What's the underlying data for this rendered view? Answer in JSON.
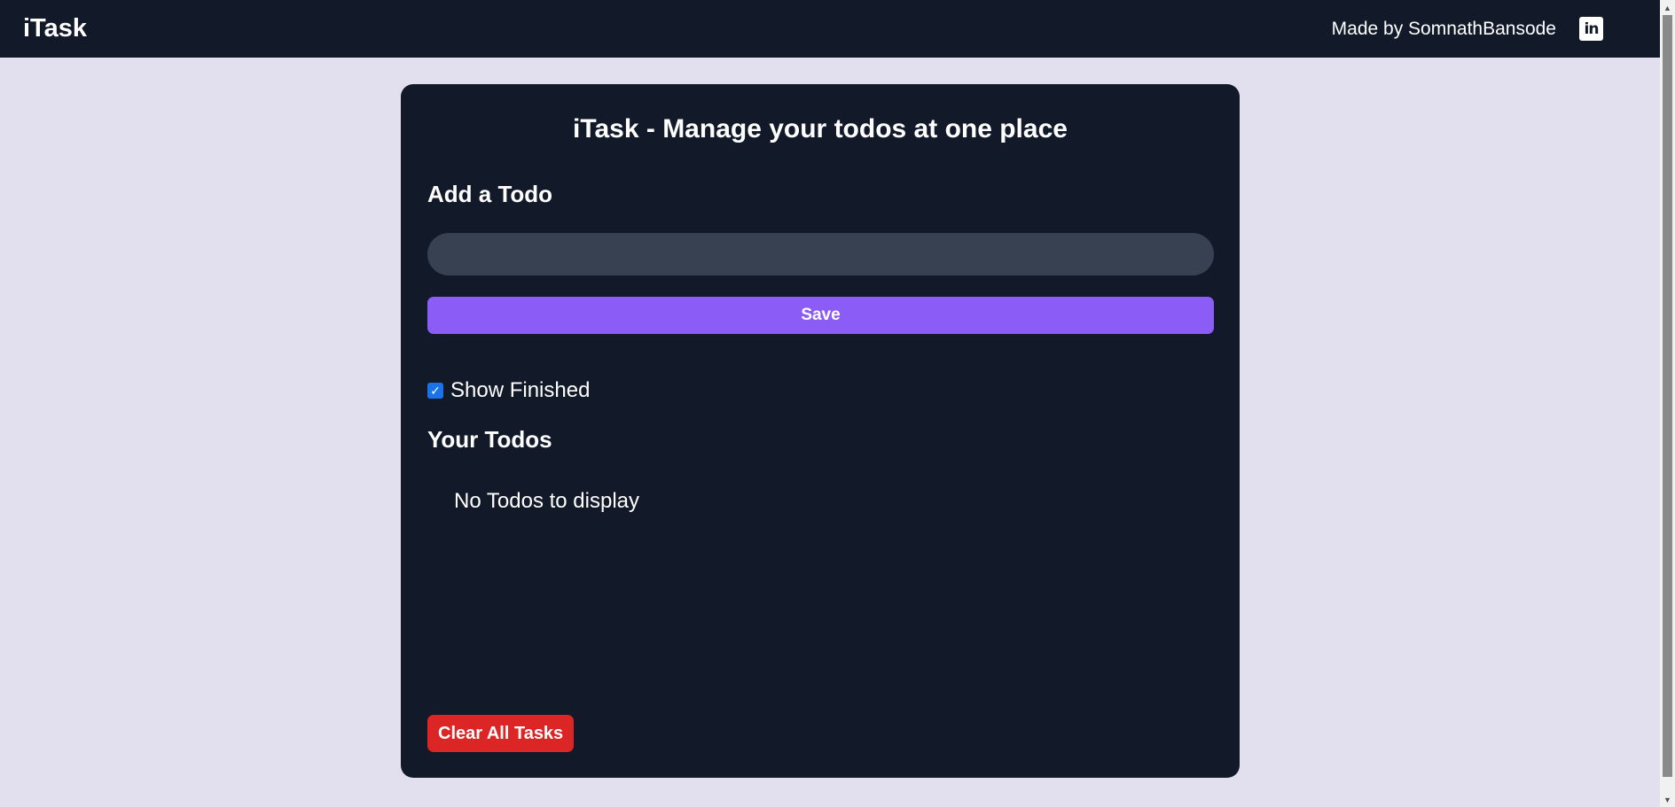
{
  "navbar": {
    "brand": "iTask",
    "made_by": "Made by SomnathBansode",
    "linkedin_icon": "linkedin-icon",
    "linkedin_glyph": "in"
  },
  "card": {
    "title": "iTask - Manage your todos at one place",
    "add_heading": "Add a Todo",
    "input_value": "",
    "save_label": "Save",
    "show_finished_label": "Show Finished",
    "show_finished_checked": true,
    "checkbox_glyph": "✓",
    "todos_heading": "Your Todos",
    "empty_message": "No Todos to display",
    "clear_label": "Clear All Tasks"
  },
  "colors": {
    "navbar_bg": "#121a2a",
    "page_bg": "#e2e0ee",
    "save_button": "#8b5cf6",
    "clear_button": "#dc2626",
    "input_bg": "#374152"
  },
  "scrollbar": {
    "up_glyph": "▲",
    "down_glyph": "▼"
  }
}
